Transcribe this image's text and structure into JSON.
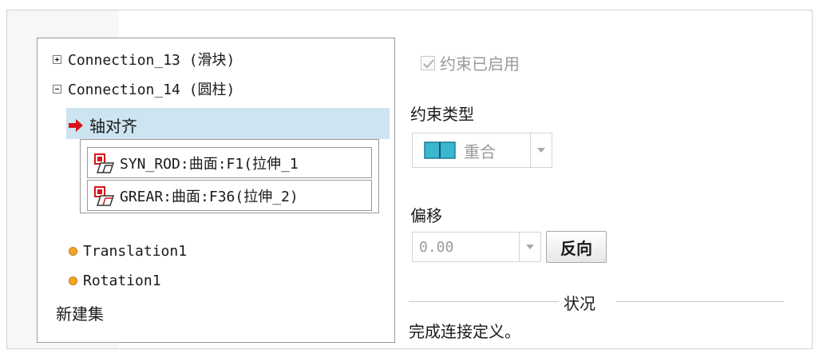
{
  "tree": {
    "items": [
      {
        "label": "Connection_13 (滑块)",
        "expander": "plus"
      },
      {
        "label": "Connection_14 (圆柱)",
        "expander": "minus"
      }
    ],
    "selected_constraint": "轴对齐",
    "references": [
      {
        "label": "SYN_ROD:曲面:F1(拉伸_1",
        "icon": "part-surface-icon"
      },
      {
        "label": "GREAR:曲面:F36(拉伸_2)",
        "icon": "part-surface-icon"
      }
    ],
    "motions": [
      {
        "label": "Translation1",
        "icon": "orange-dot-icon"
      },
      {
        "label": "Rotation1",
        "icon": "orange-dot-icon"
      }
    ],
    "new_set": "新建集"
  },
  "panel": {
    "constraint_enabled_label": "约束已启用",
    "constraint_enabled_checked": true,
    "constraint_type_label": "约束类型",
    "constraint_type_value": "重合",
    "offset_label": "偏移",
    "offset_value": "0.00",
    "flip_button": "反向",
    "status_title": "状况",
    "status_text": "完成连接定义。"
  },
  "colors": {
    "selection": "#cde4f1",
    "arrow": "#d8141c",
    "dot": "#f3a623",
    "coincident_icon": "#39b7cf"
  }
}
